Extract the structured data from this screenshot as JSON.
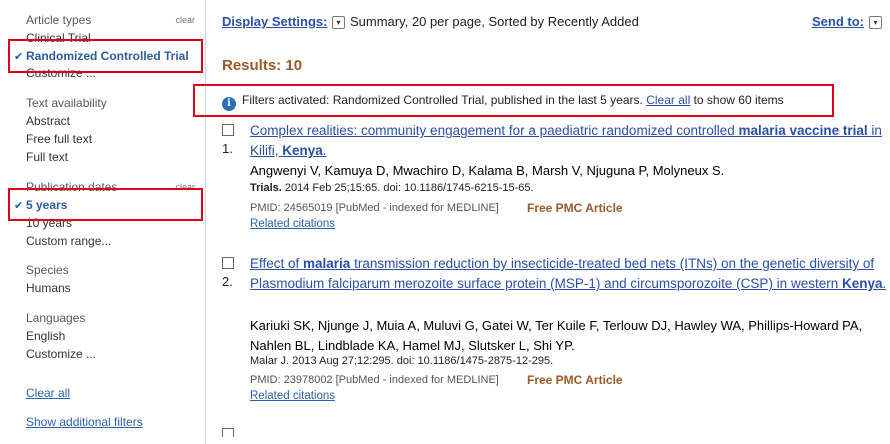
{
  "sidebar": {
    "article_types": {
      "heading": "Article types",
      "clear": "clear",
      "items": [
        "Clinical Trial",
        "Randomized Controlled Trial",
        "Customize ..."
      ]
    },
    "text_availability": {
      "heading": "Text availability",
      "items": [
        "Abstract",
        "Free full text",
        "Full text"
      ]
    },
    "publication_dates": {
      "heading": "Publication dates",
      "clear": "clear",
      "items": [
        "5 years",
        "10 years",
        "Custom range..."
      ]
    },
    "species": {
      "heading": "Species",
      "items": [
        "Humans"
      ]
    },
    "languages": {
      "heading": "Languages",
      "items": [
        "English",
        "Customize ..."
      ]
    },
    "clear_all": "Clear all",
    "show_additional": "Show additional filters",
    "check_glyph": "✔"
  },
  "toolbar": {
    "display_settings": "Display Settings:",
    "display_summary": "Summary, 20 per page, Sorted by Recently Added",
    "send_to": "Send to:",
    "dropdown_glyph": "▾"
  },
  "results_label": "Results: 10",
  "filter_notice": {
    "icon": "info-icon",
    "icon_glyph": "i",
    "text": "Filters activated: Randomized Controlled Trial, published in the last 5 years.",
    "link": "Clear all",
    "suffix": "to show 60 items"
  },
  "results": [
    {
      "number": "1.",
      "title_parts": [
        {
          "t": "Complex realities: community engagement for a paediatric randomized controlled ",
          "b": false
        },
        {
          "t": "malaria vaccine trial",
          "b": true
        },
        {
          "t": " in Kilifi, ",
          "b": false
        },
        {
          "t": "Kenya",
          "b": true
        },
        {
          "t": ".",
          "b": false
        }
      ],
      "authors": "Angwenyi V, Kamuya D, Mwachiro D, Kalama B, Marsh V, Njuguna P, Molyneux S.",
      "journal_name": "Trials.",
      "journal_rest": " 2014 Feb 25;15:65. doi: 10.1186/1745-6215-15-65.",
      "pmid": "PMID: 24565019 [PubMed - indexed for MEDLINE]",
      "pmc": "Free PMC Article",
      "related": "Related citations"
    },
    {
      "number": "2.",
      "title_parts": [
        {
          "t": "Effect of ",
          "b": false
        },
        {
          "t": "malaria",
          "b": true
        },
        {
          "t": " transmission reduction by insecticide-treated bed nets (ITNs) on the genetic diversity of Plasmodium falciparum merozoite surface protein (MSP-1) and circumsporozoite (CSP) in western ",
          "b": false
        },
        {
          "t": "Kenya",
          "b": true
        },
        {
          "t": ".",
          "b": false
        }
      ],
      "authors": "Kariuki SK, Njunge J, Muia A, Muluvi G, Gatei W, Ter Kuile F, Terlouw DJ, Hawley WA, Phillips-Howard PA, Nahlen BL, Lindblade KA, Hamel MJ, Slutsker L, Shi YP.",
      "journal_name": "Malar J.",
      "journal_rest": " 2013 Aug 27;12:295. doi: 10.1186/1475-2875-12-295.",
      "pmid": "PMID: 23978002 [PubMed - indexed for MEDLINE]",
      "pmc": "Free PMC Article",
      "related": "Related citations"
    }
  ],
  "colors": {
    "highlight_box": "#e0001b",
    "link": "#2a4fa7",
    "results": "#9a5a2a"
  }
}
